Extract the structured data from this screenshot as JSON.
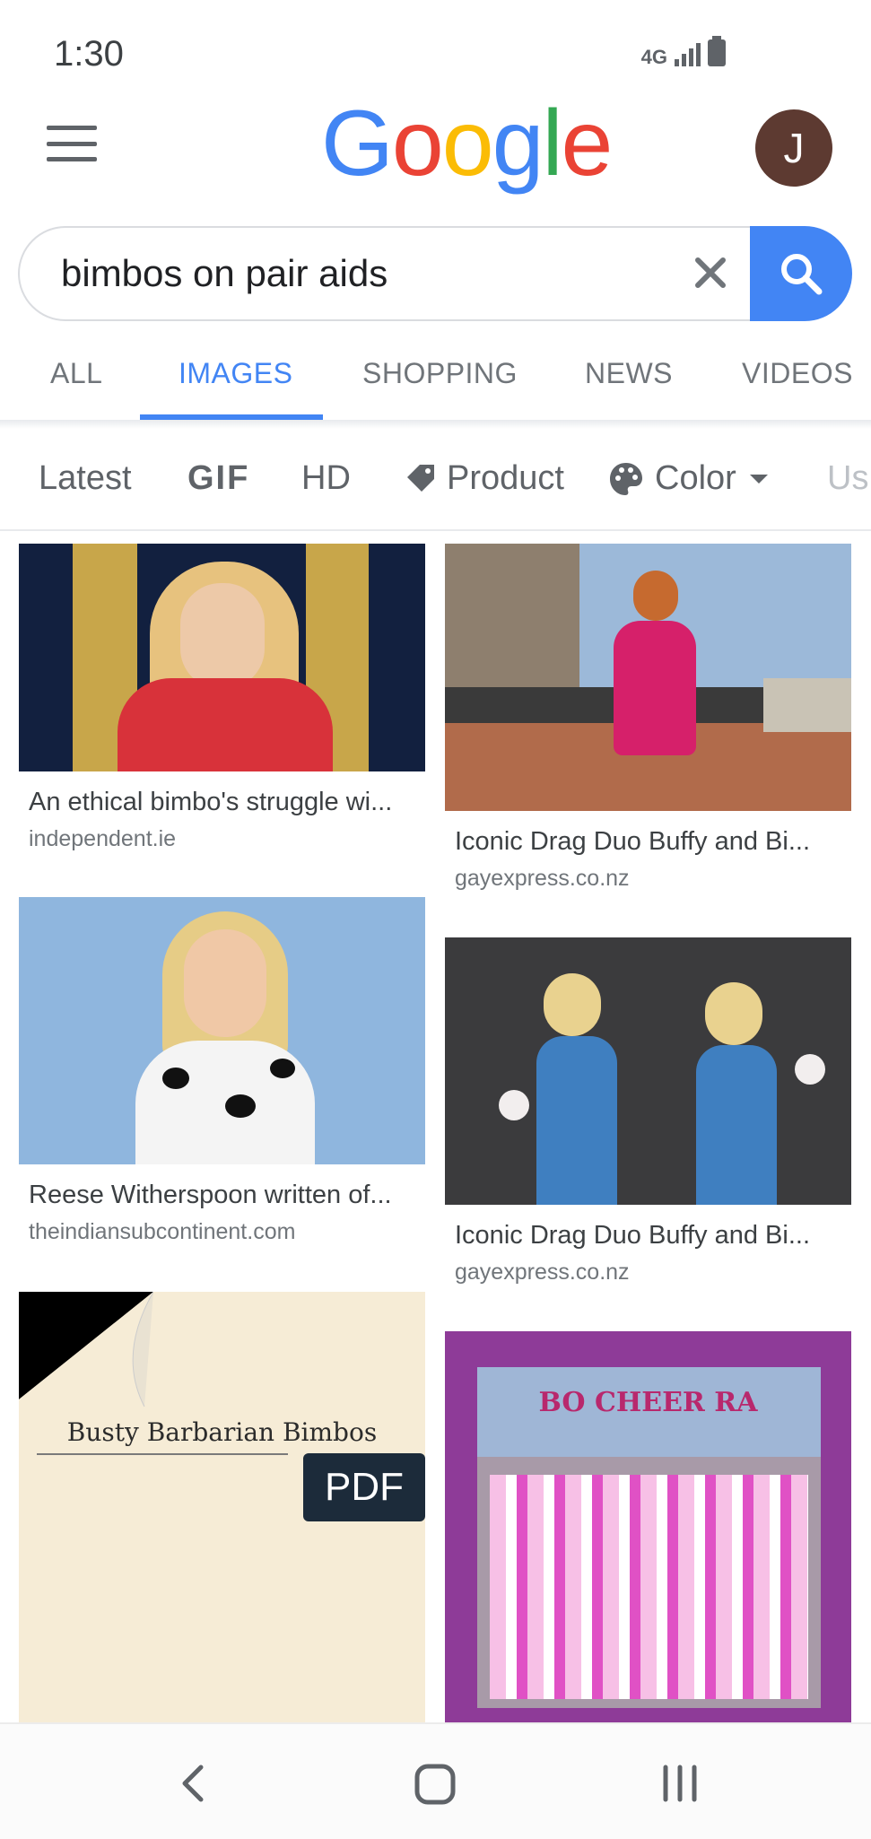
{
  "status_bar": {
    "time": "1:30",
    "network": "4G"
  },
  "header": {
    "logo_text": "Google",
    "avatar_letter": "J"
  },
  "search": {
    "query": "bimbos on pair aids"
  },
  "tabs": [
    {
      "label": "ALL"
    },
    {
      "label": "IMAGES"
    },
    {
      "label": "SHOPPING"
    },
    {
      "label": "NEWS"
    },
    {
      "label": "VIDEOS"
    }
  ],
  "filters": {
    "latest": "Latest",
    "gif": "GIF",
    "hd": "HD",
    "product": "Product",
    "color": "Color",
    "usage": "Us"
  },
  "results": [
    {
      "title": "An ethical bimbo's struggle wi...",
      "domain": "independent.ie"
    },
    {
      "title": "Iconic Drag Duo Buffy and Bi...",
      "domain": "gayexpress.co.nz"
    },
    {
      "title": "Reese Witherspoon written of...",
      "domain": "theindiansubcontinent.com"
    },
    {
      "title": "Iconic Drag Duo Buffy and Bi...",
      "domain": "gayexpress.co.nz"
    },
    {
      "doc_title": "Busty Barbarian Bimbos",
      "badge": "PDF"
    },
    {
      "banner_text": "BO CHEER RA"
    }
  ],
  "colors": {
    "accent_blue": "#4285f4",
    "avatar_bg": "#5d3a31",
    "google_blue": "#4285f4",
    "google_red": "#ea4335",
    "google_yellow": "#fbbc05",
    "google_green": "#34a853"
  }
}
